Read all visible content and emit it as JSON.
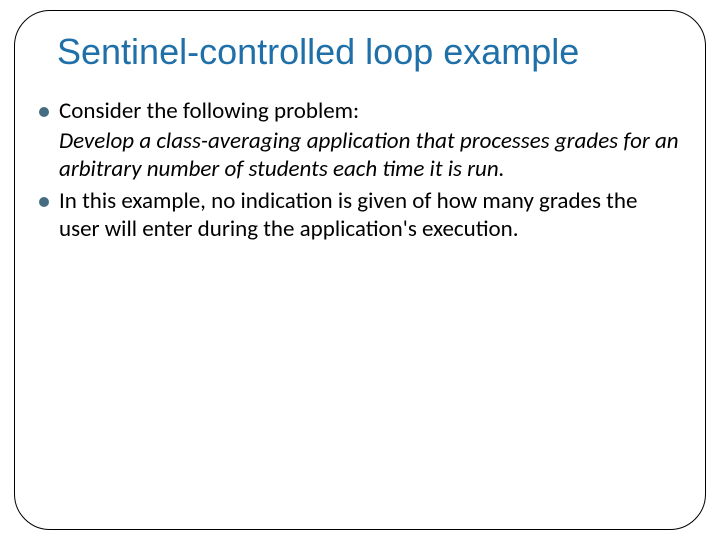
{
  "title": "Sentinel-controlled loop example",
  "bullets": {
    "b1": "Consider the following problem:",
    "quote": "Develop a class-averaging application that processes grades for an arbitrary number of students each time it is run.",
    "b2": "In this example, no indication is given of how many grades the user will enter during the application's execution."
  }
}
